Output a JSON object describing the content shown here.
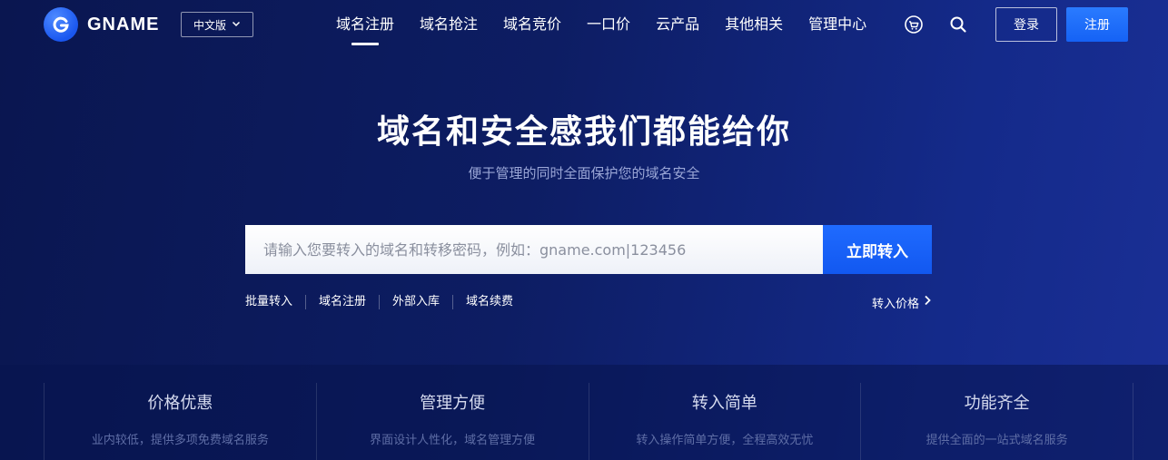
{
  "header": {
    "logo_text": "GNAME",
    "language": "中文版",
    "nav": [
      {
        "label": "域名注册",
        "active": true
      },
      {
        "label": "域名抢注"
      },
      {
        "label": "域名竞价"
      },
      {
        "label": "一口价"
      },
      {
        "label": "云产品"
      },
      {
        "label": "其他相关"
      },
      {
        "label": "管理中心"
      }
    ],
    "login_label": "登录",
    "register_label": "注册"
  },
  "hero": {
    "title": "域名和安全感我们都能给你",
    "subtitle": "便于管理的同时全面保护您的域名安全",
    "search_placeholder": "请输入您要转入的域名和转移密码，例如：gname.com|123456",
    "search_value": "",
    "search_button": "立即转入",
    "quick_links": [
      "批量转入",
      "域名注册",
      "外部入库",
      "域名续费"
    ],
    "price_link": "转入价格"
  },
  "features": [
    {
      "title": "价格优惠",
      "desc": "业内较低，提供多项免费域名服务"
    },
    {
      "title": "管理方便",
      "desc": "界面设计人性化，域名管理方便"
    },
    {
      "title": "转入简单",
      "desc": "转入操作简单方便，全程高效无忧"
    },
    {
      "title": "功能齐全",
      "desc": "提供全面的一站式域名服务"
    }
  ],
  "colors": {
    "accent": "#1562f5",
    "background": "#0b1a5c"
  },
  "icons": {
    "logo": "g-shield-icon",
    "language": "chevron-down-icon",
    "cart": "cart-icon",
    "search": "search-icon",
    "price": "chevron-right-icon"
  }
}
